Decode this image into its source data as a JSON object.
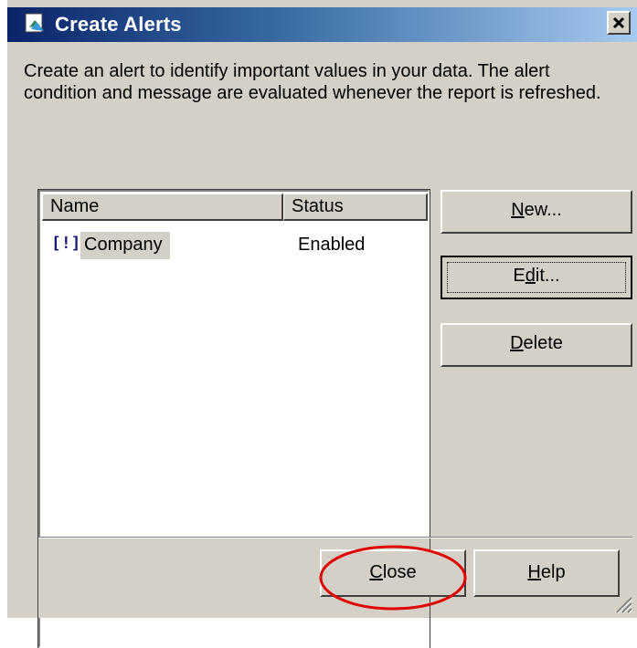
{
  "window": {
    "title": "Create Alerts",
    "title_icon": "alerts-app-icon",
    "close_icon": "close-icon"
  },
  "description": "Create an alert to identify important values in your data. The alert condition and message are evaluated whenever the report is refreshed.",
  "alerts_list": {
    "columns": [
      "Name",
      "Status"
    ],
    "rows": [
      {
        "icon": "[!]",
        "name": "Company",
        "status": "Enabled",
        "selected": true
      }
    ]
  },
  "buttons": {
    "new": {
      "before": "",
      "mnemonic": "N",
      "after": "ew..."
    },
    "edit": {
      "before": "E",
      "mnemonic": "d",
      "after": "it..."
    },
    "delete": {
      "before": "",
      "mnemonic": "D",
      "after": "elete"
    },
    "close": {
      "before": "",
      "mnemonic": "C",
      "after": "lose"
    },
    "help": {
      "before": "",
      "mnemonic": "H",
      "after": "elp"
    }
  },
  "colors": {
    "dialog_face": "#d4d0c8",
    "titlebar_start": "#0a246a",
    "titlebar_end": "#a6caf0",
    "annotation_circle": "#e00000"
  }
}
